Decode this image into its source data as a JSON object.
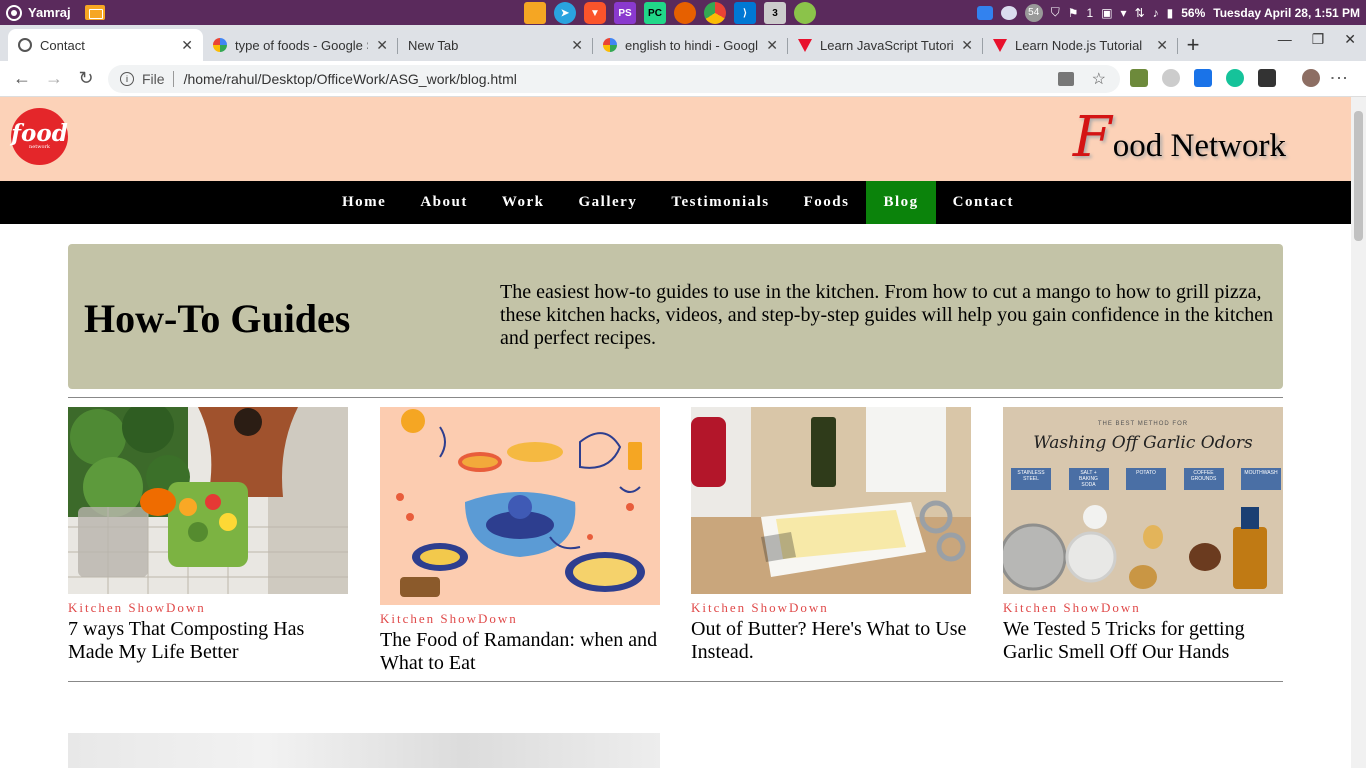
{
  "os_bar": {
    "username": "Yamraj",
    "tray_badge": "1",
    "battery": "56%",
    "datetime": "Tuesday April 28,  1:51 PM",
    "dock_badge": "3",
    "tray_count": "54"
  },
  "browser": {
    "tabs": [
      {
        "label": "Contact",
        "icon": "info-icon"
      },
      {
        "label": "type of foods - Google S",
        "icon": "google-icon"
      },
      {
        "label": "New Tab",
        "icon": "none"
      },
      {
        "label": "english to hindi - Google",
        "icon": "google-icon"
      },
      {
        "label": "Learn JavaScript Tutori",
        "icon": "vivaldi-icon"
      },
      {
        "label": "Learn Node.js Tutorial",
        "icon": "vivaldi-icon"
      }
    ],
    "url_scheme": "File",
    "url": "/home/rahul/Desktop/OfficeWork/ASG_work/blog.html"
  },
  "site": {
    "logo_big": "food",
    "logo_small": "network",
    "brand_first": "F",
    "brand_rest": "ood Network",
    "nav": [
      "Home",
      "About",
      "Work",
      "Gallery",
      "Testimonials",
      "Foods",
      "Blog",
      "Contact"
    ],
    "active_nav": "Blog",
    "hero_title": "How-To Guides",
    "hero_text": "The easiest how-to guides to use in the kitchen. From how to cut a mango to how to grill pizza, these kitchen hacks, videos, and step-by-step guides will help you gain confidence in the kitchen and perfect recipes.",
    "cards": [
      {
        "category": "Kitchen ShowDown",
        "title": "7 ways That Composting Has Made My Life Better"
      },
      {
        "category": "Kitchen ShowDown",
        "title": "The Food of Ramandan: when and What to Eat"
      },
      {
        "category": "Kitchen ShowDown",
        "title": "Out of Butter? Here's What to Use Instead."
      },
      {
        "category": "Kitchen ShowDown",
        "title": "We Tested 5 Tricks for getting Garlic Smell Off Our Hands"
      }
    ],
    "card4_image_heading": "THE BEST METHOD FOR",
    "card4_image_script": "Washing Off Garlic Odors",
    "card4_image_labels": [
      "STAINLESS STEEL",
      "SALT + BAKING SODA",
      "POTATO",
      "COFFEE GROUNDS",
      "MOUTHWASH"
    ]
  },
  "colors": {
    "header_bg": "#fcd2b8",
    "nav_bg": "#000000",
    "nav_active": "#0b830b",
    "hero_bg": "#c3c3a7",
    "category": "#e04a4a",
    "os_bar": "#5a2a5c"
  }
}
